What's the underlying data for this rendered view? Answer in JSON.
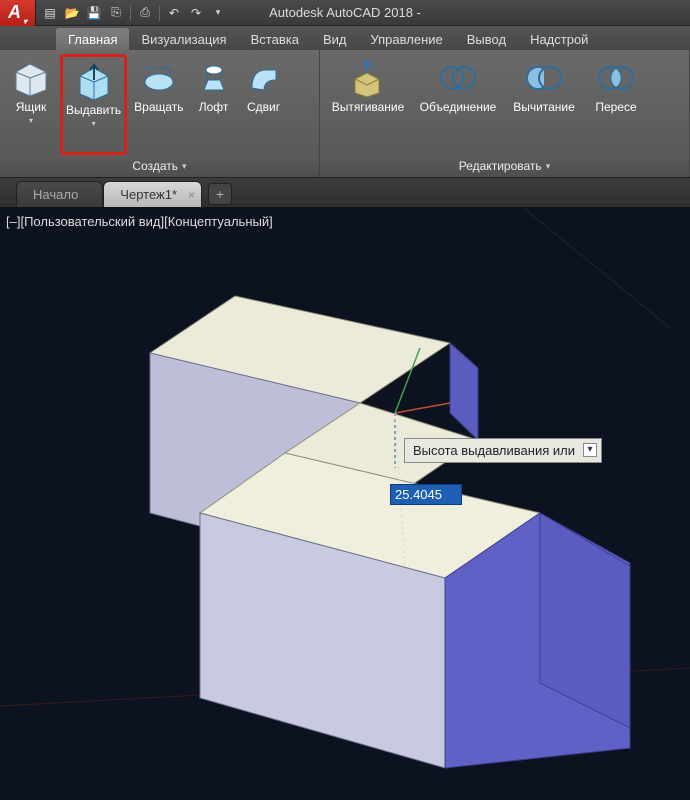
{
  "app": {
    "logo_letter": "A",
    "title": "Autodesk AutoCAD 2018 -"
  },
  "qat": {
    "new": "new",
    "open": "open",
    "save": "save",
    "saveas": "saveas",
    "print": "print",
    "undo": "undo",
    "redo": "redo"
  },
  "tabs": {
    "home": "Главная",
    "visual": "Визуализация",
    "insert": "Вставка",
    "view": "Вид",
    "manage": "Управление",
    "output": "Вывод",
    "addins": "Надстрой"
  },
  "tools": {
    "box": "Ящик",
    "extrude": "Выдавить",
    "revolve": "Вращать",
    "loft": "Лофт",
    "sweep": "Сдвиг",
    "presspull": "Вытягивание",
    "union": "Объединение",
    "subtract": "Вычитание",
    "intersect": "Пересе"
  },
  "panels": {
    "create": "Создать",
    "edit": "Редактировать"
  },
  "docs": {
    "start": "Начало",
    "drawing1": "Чертеж1*"
  },
  "viewport": {
    "label": "[–][Пользовательский вид][Концептуальный]"
  },
  "input": {
    "tooltip": "Высота выдавливания или",
    "value": "25.4045"
  }
}
